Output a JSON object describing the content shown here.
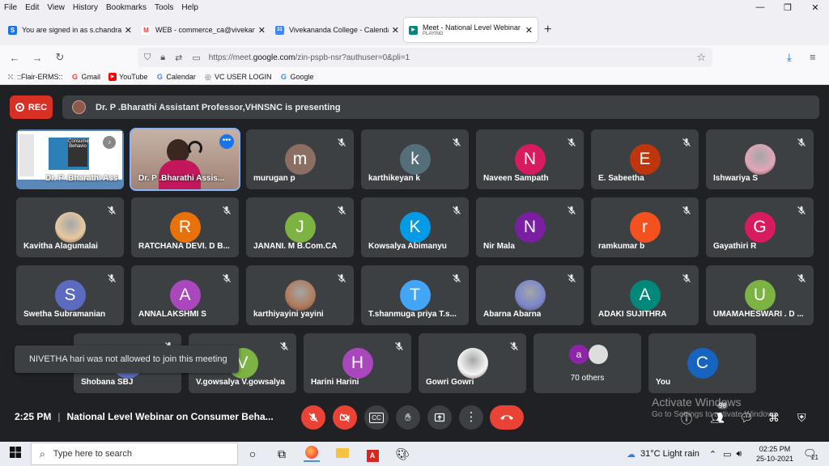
{
  "menu": [
    "File",
    "Edit",
    "View",
    "History",
    "Bookmarks",
    "Tools",
    "Help"
  ],
  "window_controls": [
    "—",
    "❐",
    "✕"
  ],
  "tabs": [
    {
      "title": "You are signed in as s.chandras",
      "color": "#1a73e8",
      "glyph": "S"
    },
    {
      "title": "WEB - commerce_ca@vivekana",
      "color": "#ea4335",
      "glyph": "M"
    },
    {
      "title": "Vivekananda College - Calenda",
      "color": "#1a73e8",
      "glyph": "31"
    },
    {
      "title": "Meet - National Level Webinar o",
      "sub": "PLAYING",
      "color": "#00897b",
      "glyph": "▶",
      "active": true
    }
  ],
  "url": {
    "pre": "https://meet.",
    "domain": "google.com",
    "post": "/zin-pspb-nsr?authuser=0&pli=1"
  },
  "bookmarks": [
    {
      "label": "::Flair-ERMS::",
      "icon": "⁙",
      "color": "#555"
    },
    {
      "label": "Gmail",
      "icon": "G",
      "color": "#ea4335"
    },
    {
      "label": "YouTube",
      "icon": "▶",
      "color": "#ff0000"
    },
    {
      "label": "Calendar",
      "icon": "G",
      "color": "#4285f4"
    },
    {
      "label": "VC USER LOGIN",
      "icon": "◎",
      "color": "#555"
    },
    {
      "label": "Google",
      "icon": "G",
      "color": "#4285f4"
    }
  ],
  "meet": {
    "rec_label": "REC",
    "presenting": "Dr. P .Bharathi Assistant Professor,VHNSNC is presenting",
    "toast": "NIVETHA hari was not allowed to join this meeting",
    "time": "2:25 PM",
    "meeting_title": "National Level Webinar on Consumer Beha...",
    "activate1": "Activate Windows",
    "activate2": "Go to Settings to activate Windows.",
    "others_label": "70 others",
    "others_letter": "a",
    "badge_count": "98"
  },
  "tiles": [
    {
      "name": "Dr. P .Bharathi Assis...",
      "type": "screen"
    },
    {
      "name": "Dr. P .Bharathi Assis...",
      "type": "presenter"
    },
    {
      "name": "murugan p",
      "letter": "m",
      "color": "#8d6e63"
    },
    {
      "name": "karthikeyan k",
      "letter": "k",
      "color": "#546e7a"
    },
    {
      "name": "Naveen Sampath",
      "letter": "N",
      "color": "#d81b60"
    },
    {
      "name": "E. Sabeetha",
      "letter": "E",
      "color": "#bf360c"
    },
    {
      "name": "Ishwariya S",
      "type": "photo",
      "color": "#e1a6b8"
    },
    {
      "name": "Kavitha Alagumalai",
      "type": "photo",
      "color": "#e8c9a0"
    },
    {
      "name": "RATCHANA DEVI. D B...",
      "letter": "R",
      "color": "#e8710a"
    },
    {
      "name": "JANANI. M B.Com.CA",
      "letter": "J",
      "color": "#7cb342"
    },
    {
      "name": "Kowsalya Abimanyu",
      "letter": "K",
      "color": "#039be5"
    },
    {
      "name": "Nir Mala",
      "letter": "N",
      "color": "#7b1fa2"
    },
    {
      "name": "ramkumar b",
      "letter": "r",
      "color": "#f4511e"
    },
    {
      "name": "Gayathiri R",
      "letter": "G",
      "color": "#d81b60"
    },
    {
      "name": "Swetha Subramanian",
      "letter": "S",
      "color": "#5c6bc0"
    },
    {
      "name": "ANNALAKSHMI S",
      "letter": "A",
      "color": "#ab47bc"
    },
    {
      "name": "karthiyayini yayini",
      "type": "photo",
      "color": "#b07a5a"
    },
    {
      "name": "T.shanmuga priya T.s...",
      "letter": "T",
      "color": "#42a5f5"
    },
    {
      "name": "Abarna Abarna",
      "type": "photo",
      "color": "#7986cb"
    },
    {
      "name": "ADAKI SUJITHRA",
      "letter": "A",
      "color": "#00897b"
    },
    {
      "name": "UMAMAHESWARI . D ...",
      "letter": "U",
      "color": "#7cb342"
    },
    {
      "name": "Shobana SBJ",
      "letter": "S",
      "color": "#5c6bc0"
    },
    {
      "name": "V.gowsalya V.gowsalya",
      "letter": "V",
      "color": "#7cb342"
    },
    {
      "name": "Harini Harini",
      "letter": "H",
      "color": "#ab47bc"
    },
    {
      "name": "Gowri Gowri",
      "type": "photo",
      "color": "#f5f5f5"
    },
    {
      "name": "70 others",
      "type": "others"
    },
    {
      "name": "You",
      "letter": "C",
      "color": "#1565c0"
    }
  ],
  "taskbar": {
    "search_placeholder": "Type here to search",
    "weather": "31°C  Light rain",
    "time": "02:25 PM",
    "date": "25-10-2021",
    "notif_count": "21"
  }
}
